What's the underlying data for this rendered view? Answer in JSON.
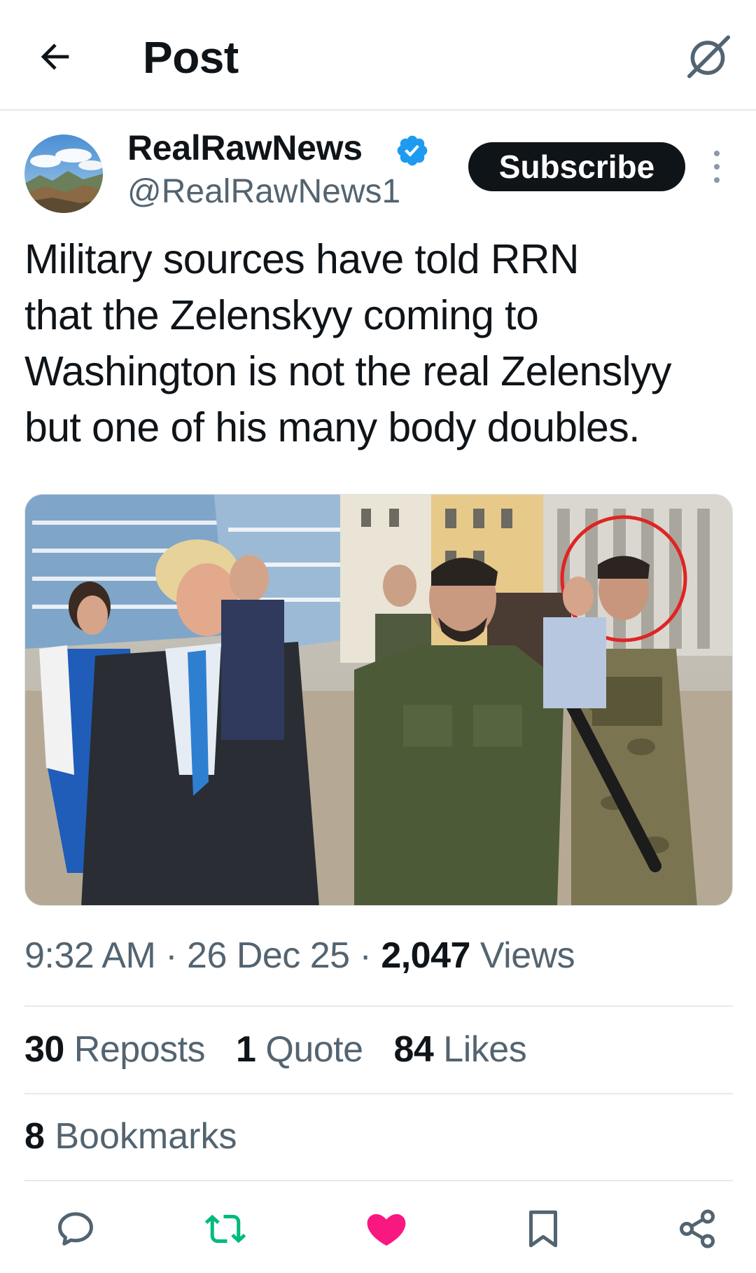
{
  "header": {
    "title": "Post",
    "back_icon": "arrow-left-icon",
    "grok_icon": "grok-icon"
  },
  "author": {
    "display_name": "RealRawNews",
    "handle": "@RealRawNews1",
    "verified": true,
    "verified_color": "#1d9bf0"
  },
  "subscribe_label": "Subscribe",
  "post": {
    "text_lines": [
      "Military sources have told RRN",
      "that the Zelenskyy coming to",
      "Washington is not the real Zelenslyy",
      "but one of his many body doubles."
    ]
  },
  "meta": {
    "time": "9:32 AM",
    "separator": "·",
    "date": "26 Dec 25",
    "views_count": "2,047",
    "views_label": "Views"
  },
  "stats": {
    "reposts_count": "30",
    "reposts_label": "Reposts",
    "quotes_count": "1",
    "quotes_label": "Quote",
    "likes_count": "84",
    "likes_label": "Likes",
    "bookmarks_count": "8",
    "bookmarks_label": "Bookmarks"
  },
  "actions": {
    "reply_icon": "reply-icon",
    "repost_icon": "repost-icon",
    "like_icon": "heart-icon",
    "bookmark_icon": "bookmark-icon",
    "share_icon": "share-icon",
    "repost_color": "#00ba7c",
    "like_color": "#f91880"
  },
  "colors": {
    "text_primary": "#0f1419",
    "text_secondary": "#536471",
    "divider": "#e7e9ea"
  }
}
